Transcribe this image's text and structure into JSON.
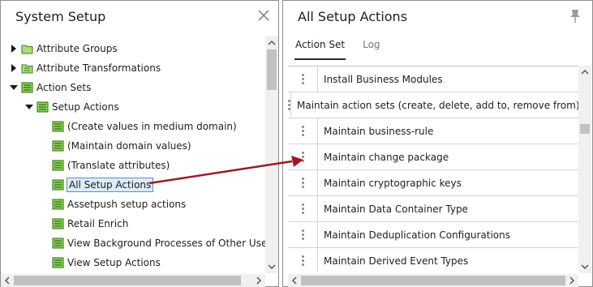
{
  "left_panel": {
    "title": "System Setup",
    "tree": [
      {
        "label": "Attribute Groups",
        "expanded": false,
        "icon": "folder-icon"
      },
      {
        "label": "Attribute Transformations",
        "expanded": false,
        "icon": "folder-icon"
      },
      {
        "label": "Action Sets",
        "expanded": true,
        "icon": "action-set-icon"
      },
      {
        "label": "Setup Actions",
        "expanded": true,
        "icon": "action-set-icon"
      },
      {
        "label": "(Create values in medium domain)",
        "icon": "action-set-icon"
      },
      {
        "label": "(Maintain domain values)",
        "icon": "action-set-icon"
      },
      {
        "label": "(Translate attributes)",
        "icon": "action-set-icon"
      },
      {
        "label": "All Setup Actions",
        "icon": "action-set-icon",
        "selected": true
      },
      {
        "label": "Assetpush setup actions",
        "icon": "action-set-icon"
      },
      {
        "label": "Retail Enrich",
        "icon": "action-set-icon"
      },
      {
        "label": "View Background Processes of Other Users",
        "icon": "action-set-icon"
      },
      {
        "label": "View Setup Actions",
        "icon": "action-set-icon"
      }
    ]
  },
  "right_panel": {
    "title": "All Setup Actions",
    "tabs": [
      "Action Set",
      "Log"
    ],
    "actions": [
      "Install Business Modules",
      "Maintain action sets (create, delete, add to, remove from)",
      "Maintain business-rule",
      "Maintain change package",
      "Maintain cryptographic keys",
      "Maintain Data Container Type",
      "Maintain Deduplication Configurations",
      "Maintain Derived Event Types"
    ]
  },
  "colors": {
    "arrow": "#9b1c24",
    "selection_bg": "#dcecf9",
    "selection_border": "#5a8fc4",
    "icon_green": "#6bbf3a"
  }
}
